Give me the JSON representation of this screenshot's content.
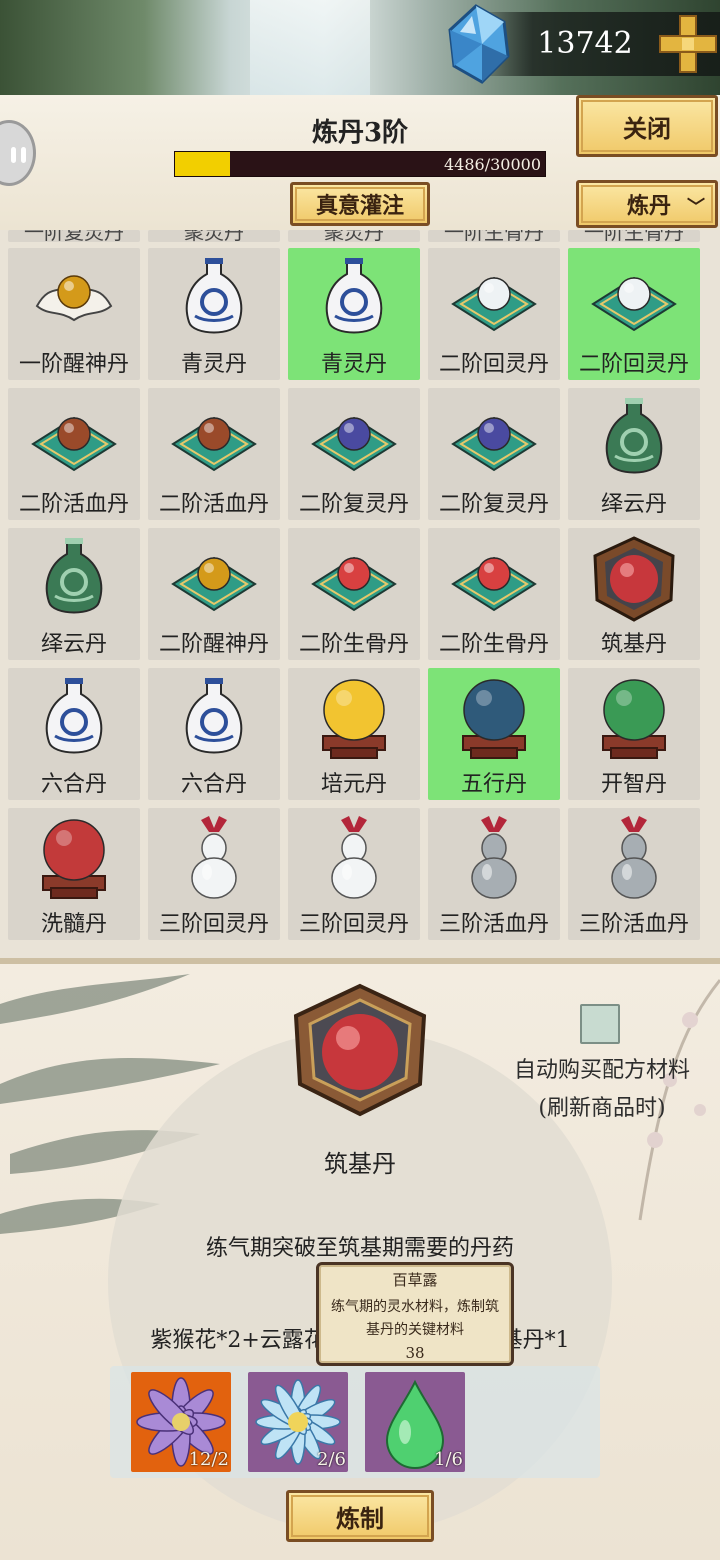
{
  "currency": {
    "amount": "13742",
    "icon": "spirit-crystal-icon"
  },
  "header": {
    "title": "炼丹3阶",
    "progress_label": "4486/30000",
    "progress_value": 4486,
    "progress_max": 30000,
    "close_label": "关闭",
    "infuse_label": "真意灌注",
    "craft_select": "炼丹"
  },
  "grid": {
    "partial_row": [
      "一阶复灵丹",
      "聚灵丹",
      "聚灵丹",
      "一阶生骨丹",
      "一阶生骨丹"
    ],
    "rows": [
      [
        {
          "name": "一阶醒神丹",
          "icon": "pill-on-cloth-gold",
          "selected": false
        },
        {
          "name": "青灵丹",
          "icon": "blue-white-vase",
          "selected": false
        },
        {
          "name": "青灵丹",
          "icon": "blue-white-vase",
          "selected": true
        },
        {
          "name": "二阶回灵丹",
          "icon": "pill-on-cushion-white",
          "selected": false
        },
        {
          "name": "二阶回灵丹",
          "icon": "pill-on-cushion-white",
          "selected": true
        }
      ],
      [
        {
          "name": "二阶活血丹",
          "icon": "pill-on-cushion-brown",
          "selected": false
        },
        {
          "name": "二阶活血丹",
          "icon": "pill-on-cushion-brown",
          "selected": false
        },
        {
          "name": "二阶复灵丹",
          "icon": "pill-on-cushion-indigo",
          "selected": false
        },
        {
          "name": "二阶复灵丹",
          "icon": "pill-on-cushion-indigo",
          "selected": false
        },
        {
          "name": "绎云丹",
          "icon": "green-vase",
          "selected": false
        }
      ],
      [
        {
          "name": "绎云丹",
          "icon": "green-vase",
          "selected": false
        },
        {
          "name": "二阶醒神丹",
          "icon": "pill-on-cushion-gold",
          "selected": false
        },
        {
          "name": "二阶生骨丹",
          "icon": "pill-on-cushion-red",
          "selected": false
        },
        {
          "name": "二阶生骨丹",
          "icon": "pill-on-cushion-red",
          "selected": false
        },
        {
          "name": "筑基丹",
          "icon": "pill-in-hex-box",
          "selected": false
        }
      ],
      [
        {
          "name": "六合丹",
          "icon": "blue-white-vase",
          "selected": false
        },
        {
          "name": "六合丹",
          "icon": "blue-white-vase",
          "selected": false
        },
        {
          "name": "培元丹",
          "icon": "orb-on-stand-yellow",
          "selected": false
        },
        {
          "name": "五行丹",
          "icon": "orb-on-stand-blue",
          "selected": true
        },
        {
          "name": "开智丹",
          "icon": "orb-on-stand-green",
          "selected": false
        }
      ],
      [
        {
          "name": "洗髓丹",
          "icon": "orb-on-stand-red",
          "selected": false
        },
        {
          "name": "三阶回灵丹",
          "icon": "white-gourd-vase",
          "selected": false
        },
        {
          "name": "三阶回灵丹",
          "icon": "white-gourd-vase",
          "selected": false
        },
        {
          "name": "三阶活血丹",
          "icon": "silver-gourd-vase",
          "selected": false
        },
        {
          "name": "三阶活血丹",
          "icon": "silver-gourd-vase",
          "selected": false
        }
      ]
    ]
  },
  "detail": {
    "selected_name": "筑基丹",
    "selected_icon": "pill-in-hex-box",
    "auto_buy_label_1": "自动购买配方材料",
    "auto_buy_label_2": "(刷新商品时)",
    "auto_buy_checked": false,
    "description": "练气期突破至筑基期需要的丹药",
    "recipe": "紫猴花*2+云露花*6+百草露*1=筑基丹*1",
    "tooltip": {
      "title": "百草露",
      "desc": "练气期的灵水材料，炼制筑基丹的关键材料",
      "number": "38"
    },
    "materials": [
      {
        "name": "紫猴花",
        "icon": "purple-lotus-icon",
        "count": "12/2",
        "bg": "#e2620e"
      },
      {
        "name": "云露花",
        "icon": "blue-flower-icon",
        "count": "2/6",
        "bg": "#8a5a92"
      },
      {
        "name": "百草露",
        "icon": "green-droplet-icon",
        "count": "1/6",
        "bg": "#8a5a92"
      }
    ],
    "refine_label": "炼制"
  },
  "colors": {
    "selected_cell": "#7de377",
    "cell": "#d9d4cb",
    "progress_fill": "#f2cf00",
    "progress_track": "#2a1216",
    "button_gold": "#f0c969",
    "button_border": "#7a4d23"
  }
}
